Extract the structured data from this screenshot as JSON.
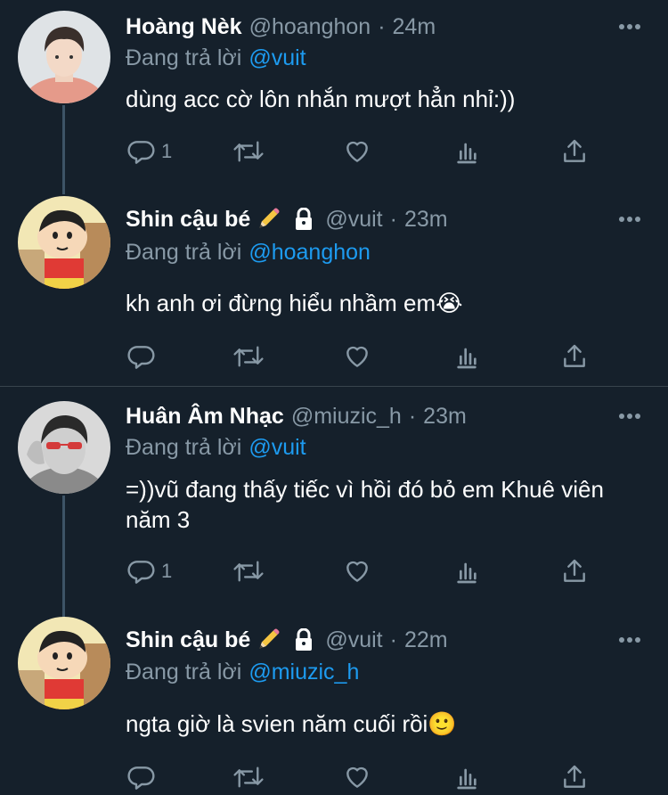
{
  "tweets": [
    {
      "name": "Hoàng Nèk",
      "handle": "@hoanghon",
      "sep": "·",
      "time": "24m",
      "replying_prefix": "Đang trả lời",
      "replying_to": "@vuit",
      "text": "dùng acc cờ lôn nhắn mượt hẳn nhỉ:))",
      "reply_count": "1",
      "has_pencil": false,
      "has_lock": false
    },
    {
      "name": "Shin cậu bé",
      "handle": "@vuit",
      "sep": "·",
      "time": "23m",
      "replying_prefix": "Đang trả lời",
      "replying_to": "@hoanghon",
      "text": "kh anh ơi đừng hiểu nhầm em😭",
      "reply_count": "",
      "has_pencil": true,
      "has_lock": true
    },
    {
      "name": "Huân Âm Nhạc",
      "handle": "@miuzic_h",
      "sep": "·",
      "time": "23m",
      "replying_prefix": "Đang trả lời",
      "replying_to": "@vuit",
      "text": "=))vũ đang thấy tiếc vì hồi đó bỏ em Khuê viên năm 3",
      "reply_count": "1",
      "has_pencil": false,
      "has_lock": false
    },
    {
      "name": "Shin cậu bé",
      "handle": "@vuit",
      "sep": "·",
      "time": "22m",
      "replying_prefix": "Đang trả lời",
      "replying_to": "@miuzic_h",
      "text": "ngta giờ là svien năm cuối rồi🙂",
      "reply_count": "",
      "has_pencil": true,
      "has_lock": true
    }
  ],
  "colors": {
    "background": "#15202b",
    "secondary_text": "#8899a6",
    "mention": "#1d9bf0",
    "thread_line": "#3d5466"
  }
}
